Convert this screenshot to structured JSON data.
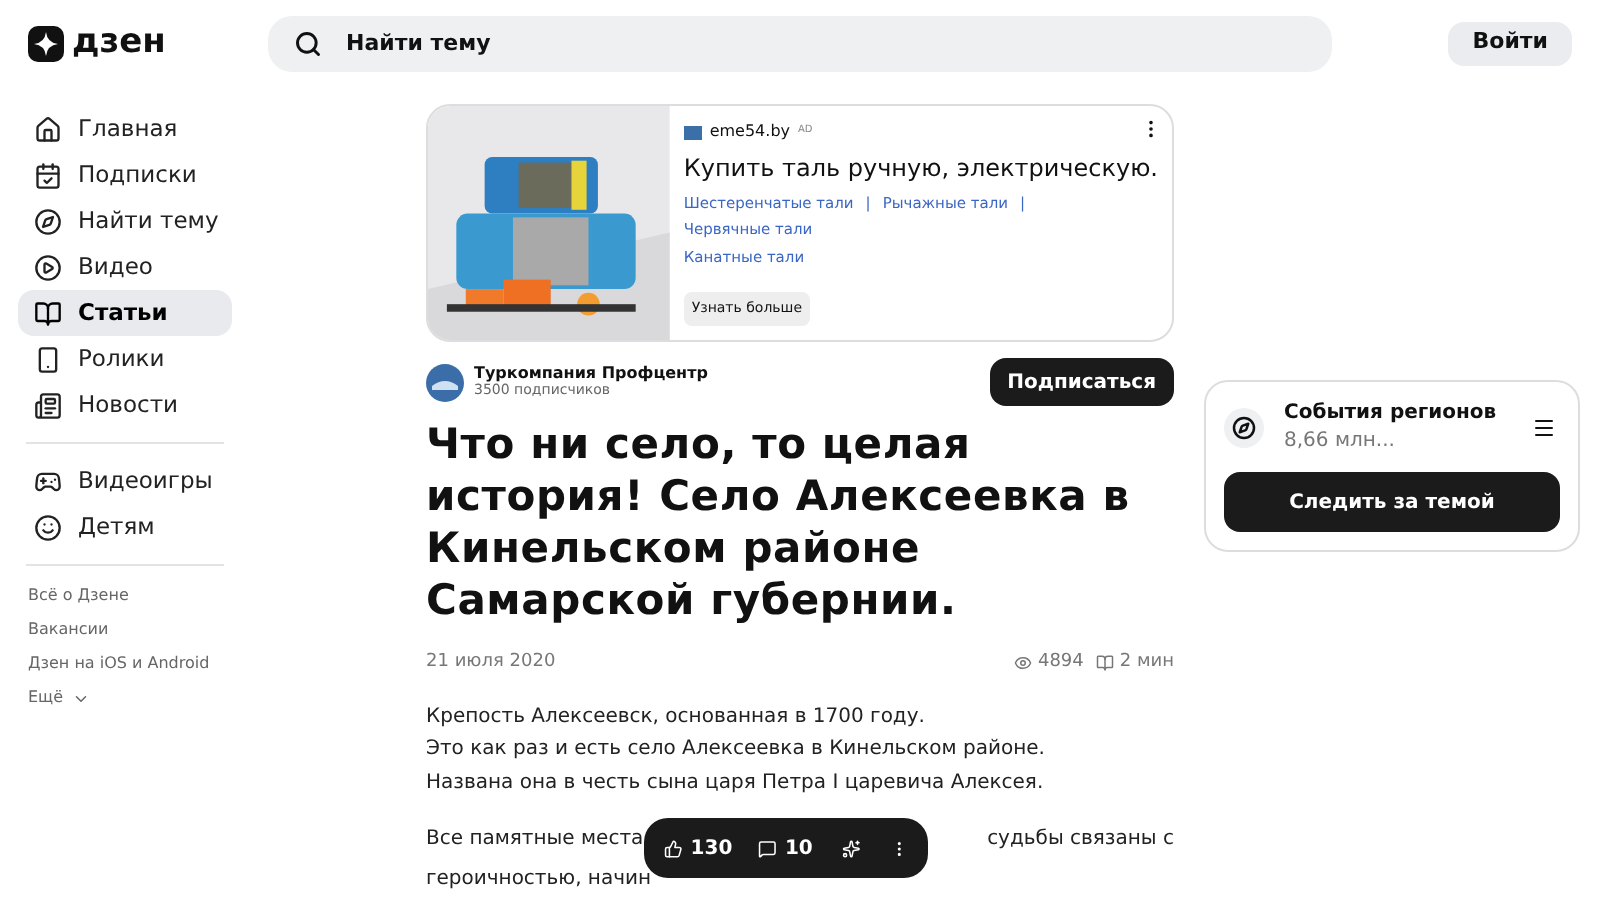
{
  "header": {
    "logo": "дзен",
    "search": {
      "placeholder": "Найти тему"
    },
    "login": "Войти"
  },
  "sidebar": {
    "items": [
      {
        "label": "Главная",
        "selected": false
      },
      {
        "label": "Подписки",
        "selected": false
      },
      {
        "label": "Найти тему",
        "selected": false
      },
      {
        "label": "Видео",
        "selected": false
      },
      {
        "label": "Статьи",
        "selected": true
      },
      {
        "label": "Ролики",
        "selected": false
      },
      {
        "label": "Новости",
        "selected": false
      }
    ],
    "extra": [
      {
        "label": "Видеоигры",
        "selected": false
      },
      {
        "label": "Детям",
        "selected": false
      }
    ],
    "links": [
      "Всё о Дзене",
      "Вакансии",
      "Дзен на iOS и Android"
    ],
    "more": "Ещё"
  },
  "ad": {
    "domain": "eme54.by",
    "ad_label": "AD",
    "title": "Купить таль ручную, электрическую.",
    "links": [
      "Шестеренчатые тали",
      "Рычажные тали",
      "Червячные тали",
      "Канатные тали"
    ],
    "separator": "|",
    "button": "Узнать больше"
  },
  "author": {
    "name": "Туркомпания Профцентр",
    "subscribers": "3500 подписчиков",
    "subscribe": "Подписаться"
  },
  "article": {
    "title": "Что ни село, то целая история! Село Алексеевка в Кинельском районе Самарской губернии.",
    "date": "21 июля 2020",
    "views": "4894",
    "read_time": "2 мин",
    "paragraph_1": [
      "Крепость Алексеевск, основанная в 1700 году.",
      "Это как раз и есть село Алексеевка в Кинельском районе.",
      "Названа она в честь сына царя Петра I царевича Алексея."
    ],
    "paragraph_2": {
      "line_1_start": "Все памятные места",
      "line_1_end": "судьбы связаны с",
      "line_2_start": "героичностью, начин"
    }
  },
  "action_bar": {
    "likes": "130",
    "comments": "10"
  },
  "topic_card": {
    "title": "События регионов",
    "subtitle": "8,66 млн...",
    "follow": "Следить за темой"
  }
}
